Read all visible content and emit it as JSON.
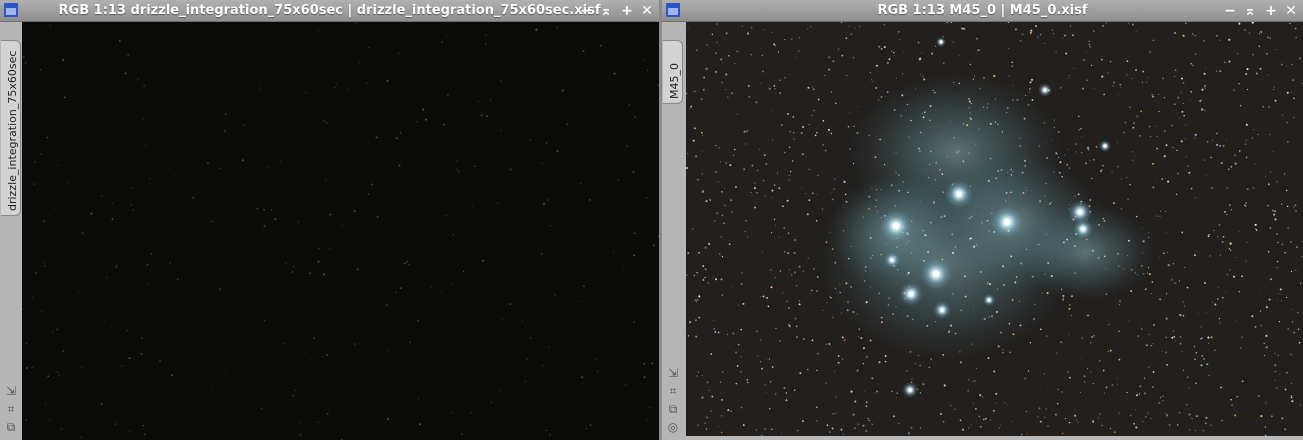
{
  "left_window": {
    "title": "RGB 1:13 drizzle_integration_75x60sec | drizzle_integration_75x60sec.xisf",
    "tab_label": "drizzle_integration_75x60sec",
    "icons": [
      "window-icon",
      "minimize-icon",
      "shade-icon",
      "maximize-icon",
      "close-icon"
    ],
    "tools": [
      "fit-view-icon",
      "zoom-icon",
      "clone-icon"
    ]
  },
  "right_window": {
    "title": "RGB 1:13 M45_0 | M45_0.xisf",
    "tab_label": "M45_0",
    "icons": [
      "window-icon",
      "minimize-icon",
      "shade-icon",
      "maximize-icon",
      "close-icon"
    ],
    "tools": [
      "fit-view-icon",
      "zoom-icon",
      "clone-icon",
      "target-icon"
    ]
  },
  "colors": {
    "title_bar": "#9f9f9f",
    "left_image_bg": "#0b0c08",
    "right_image_bg": "#221f1d",
    "nebula": "#6fa0a8"
  }
}
